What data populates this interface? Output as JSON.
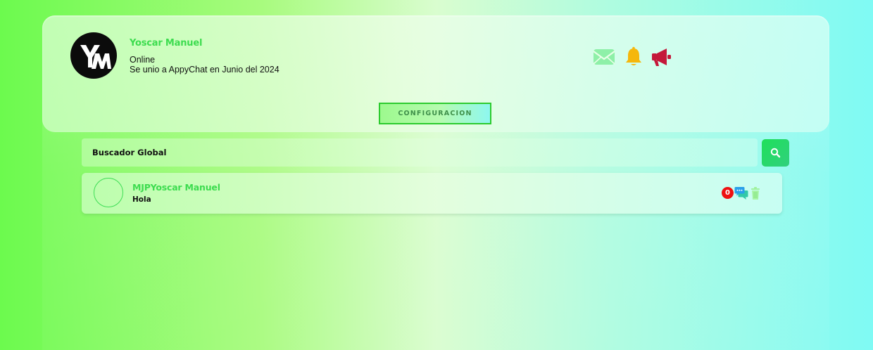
{
  "profile": {
    "avatar_initials": "YM",
    "name": "Yoscar Manuel",
    "status": "Online",
    "joined": "Se unio a AppyChat en Junio del 2024"
  },
  "header_icons": [
    {
      "name": "mail-icon",
      "color": "#7fe8a0"
    },
    {
      "name": "bell-icon",
      "color": "#f5b70c"
    },
    {
      "name": "megaphone-icon",
      "color": "#c4183a"
    }
  ],
  "config_button": {
    "label": "CONFIGURACION"
  },
  "search": {
    "value": "Buscador Global",
    "button_icon": "search-icon"
  },
  "chats": [
    {
      "name": "MJPYoscar Manuel",
      "last_message": "Hola",
      "unread_count": "0",
      "icons": [
        "chat-bubbles-icon",
        "trash-icon"
      ]
    }
  ],
  "colors": {
    "accent_green": "#3ddc4f",
    "badge_red": "#ee1111"
  }
}
